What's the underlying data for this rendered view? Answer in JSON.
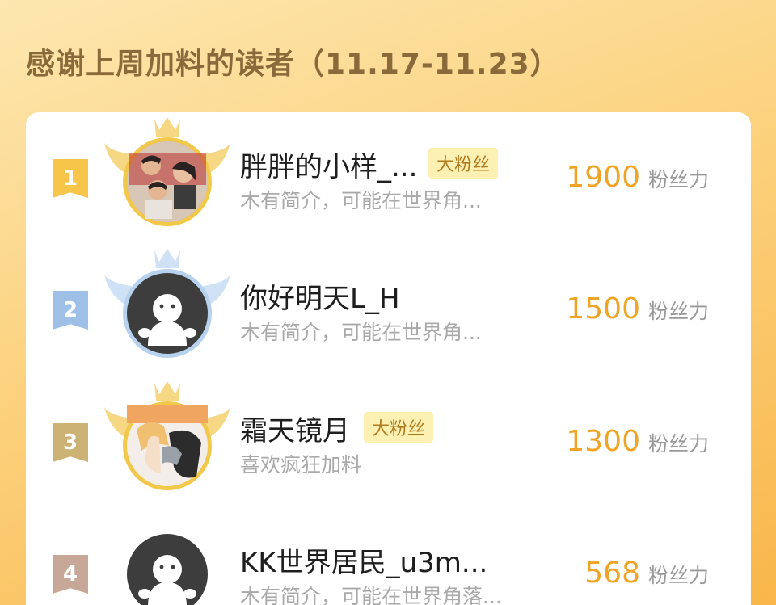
{
  "page": {
    "title": "感谢上周加料的读者（11.17-11.23）"
  },
  "readers": [
    {
      "rank": "1",
      "name": "胖胖的小样_...",
      "badge": "大粉丝",
      "bio": "木有简介，可能在世界角...",
      "score": "1900",
      "unit": "粉丝力",
      "avatar": "family-photo-avatar",
      "rank_color": "#f6c54a",
      "frame_color": "#f2c84b"
    },
    {
      "rank": "2",
      "name": "你好明天L_H",
      "badge": "",
      "bio": "木有简介，可能在世界角...",
      "score": "1500",
      "unit": "粉丝力",
      "avatar": "default-ghost-avatar",
      "rank_color": "#9fc0e6",
      "frame_color": "#b6d2ef"
    },
    {
      "rank": "3",
      "name": "霜天镜月",
      "badge": "大粉丝",
      "bio": "喜欢疯狂加料",
      "score": "1300",
      "unit": "粉丝力",
      "avatar": "anime-avatar",
      "rank_color": "#cdb276",
      "frame_color": "#f2c84b"
    },
    {
      "rank": "4",
      "name": "KK世界居民_u3m...",
      "badge": "",
      "bio": "木有简介，可能在世界角落...",
      "score": "568",
      "unit": "粉丝力",
      "avatar": "default-ghost-avatar",
      "rank_color": "#c7a797",
      "frame_color": ""
    }
  ]
}
